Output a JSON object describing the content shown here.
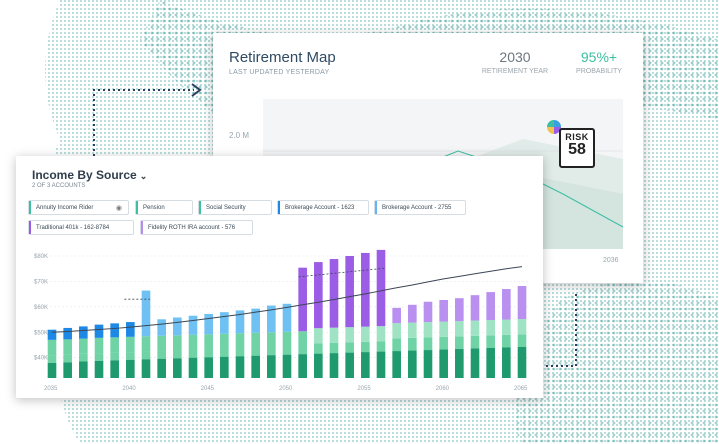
{
  "retirement_map": {
    "title": "Retirement Map",
    "subtitle": "LAST UPDATED YESTERDAY",
    "retirement_year": {
      "value": "2030",
      "label": "RETIREMENT YEAR"
    },
    "probability": {
      "value": "95%+",
      "label": "PROBABILITY"
    },
    "y_axis_label": "2.0 M",
    "x_axis_label": "2036",
    "risk": {
      "label": "RISK",
      "value": "58"
    }
  },
  "income_by_source": {
    "title": "Income By Source",
    "subtitle": "2 OF 3 ACCOUNTS",
    "chips": [
      {
        "label": "Annuity Income Rider",
        "color": "#3cbfa2",
        "icon": "eye-slash-icon"
      },
      {
        "label": "Pension",
        "color": "#3cbfa2"
      },
      {
        "label": "Social Security",
        "color": "#3cbfa2"
      },
      {
        "label": "Brokerage Account - 1623",
        "color": "#1e88e5"
      },
      {
        "label": "Brokerage Account - 2755",
        "color": "#64b5f6"
      },
      {
        "label": "Traditional 401k - 162-8784",
        "color": "#9b5de5"
      },
      {
        "label": "Fidelity ROTH IRA account - 576",
        "color": "#b98cf0"
      }
    ],
    "colors": {
      "dark_green": "#1e9a6e",
      "light_green": "#6fd3a6",
      "blue": "#1e88e5",
      "light_blue": "#6ec1f2",
      "purple": "#9b5de5",
      "light_purple": "#b990f0"
    },
    "chart_data": {
      "type": "bar",
      "y_ticks": [
        "$80K",
        "$70K",
        "$60K",
        "$50K",
        "$40K"
      ],
      "x_ticks": [
        "2035",
        "2040",
        "2045",
        "2050",
        "2055",
        "2060",
        "2065"
      ],
      "ylim": [
        32000,
        80000
      ],
      "x": [
        2035,
        2036,
        2037,
        2038,
        2039,
        2040,
        2041,
        2042,
        2043,
        2044,
        2045,
        2046,
        2047,
        2048,
        2049,
        2050,
        2051,
        2052,
        2053,
        2054,
        2055,
        2056,
        2057,
        2058,
        2059,
        2060,
        2061,
        2062,
        2063,
        2064,
        2065
      ],
      "series": [
        {
          "values": [
            38000,
            38200,
            38500,
            38800,
            39000,
            39200,
            39400,
            39600,
            39800,
            40000,
            40200,
            40400,
            40600,
            40800,
            41000,
            41200,
            41400,
            41600,
            41800,
            42000,
            42200,
            42400,
            42600,
            42800,
            43000,
            43200,
            43400,
            43600,
            43800,
            44000,
            44200
          ]
        },
        {
          "values": [
            3000,
            3000,
            3000,
            3000,
            3000,
            3000,
            3000,
            3000,
            3000,
            3000,
            3000,
            3000,
            3000,
            3000,
            3000,
            3000,
            3000,
            4000,
            4000,
            4000,
            4000,
            4000,
            5000,
            5000,
            5000,
            5000,
            5000,
            5000,
            5000,
            5000,
            5000
          ]
        },
        {
          "values": [
            6000,
            6000,
            6000,
            6000,
            6000,
            6000,
            6000,
            6000,
            6000,
            6000,
            6000,
            6000,
            6000,
            6000,
            6000,
            6000,
            6000,
            6000,
            6000,
            6000,
            6000,
            6000,
            6000,
            6000,
            6000,
            6000,
            6000,
            6000,
            6000,
            6000,
            6000
          ]
        },
        {
          "values": [
            4000,
            4500,
            4800,
            5200,
            5500,
            5800,
            18000,
            6500,
            7000,
            7500,
            8000,
            8500,
            9000,
            9500,
            10500,
            11000,
            0,
            0,
            0,
            0,
            0,
            0,
            0,
            0,
            0,
            0,
            0,
            0,
            0,
            0,
            0
          ]
        },
        {
          "values": [
            0,
            0,
            0,
            0,
            0,
            0,
            0,
            0,
            0,
            0,
            0,
            0,
            0,
            0,
            0,
            0,
            25000,
            26000,
            27000,
            28000,
            29000,
            30000,
            6000,
            7000,
            8000,
            8500,
            9000,
            10000,
            11000,
            12000,
            13000
          ]
        }
      ],
      "trend": [
        50000,
        50300,
        50700,
        51100,
        51500,
        52000,
        52600,
        53200,
        53900,
        54600,
        55400,
        56200,
        57000,
        57900,
        58800,
        59800,
        60800,
        61800,
        62900,
        64000,
        65100,
        66300,
        67500,
        68600,
        69800,
        71000,
        72000,
        73000,
        74000,
        75000,
        75800
      ]
    }
  }
}
